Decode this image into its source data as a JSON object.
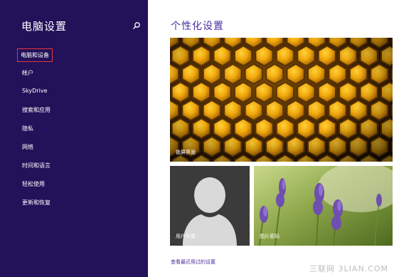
{
  "sidebar": {
    "title": "电脑设置",
    "items": [
      {
        "label": "电脑和设备",
        "selected": true
      },
      {
        "label": "帐户"
      },
      {
        "label": "SkyDrive"
      },
      {
        "label": "搜索和应用"
      },
      {
        "label": "隐私"
      },
      {
        "label": "网络"
      },
      {
        "label": "时间和语言"
      },
      {
        "label": "轻松使用"
      },
      {
        "label": "更新和恢复"
      }
    ]
  },
  "main": {
    "heading": "个性化设置",
    "tiles": {
      "lockscreen": {
        "label": "锁屏界面"
      },
      "account_picture": {
        "label": "用户头像"
      },
      "picture_password": {
        "label": "图片密码"
      }
    },
    "history_link": "查看最近用过的设置"
  },
  "watermark": "三联网 3LIAN.COM",
  "colors": {
    "sidebar_bg": "#23115a",
    "accent": "#4a2fa0",
    "selection_border": "#e53935"
  }
}
